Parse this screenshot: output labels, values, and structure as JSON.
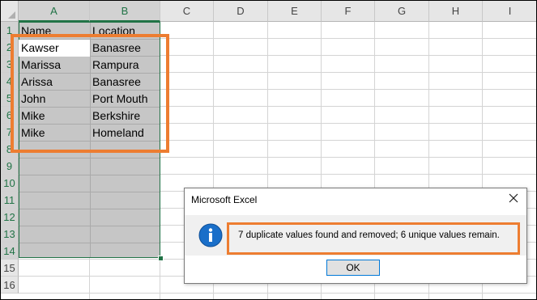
{
  "sheet": {
    "columns": [
      "A",
      "B",
      "C",
      "D",
      "E",
      "F",
      "G",
      "H",
      "I"
    ],
    "rows": [
      "1",
      "2",
      "3",
      "4",
      "5",
      "6",
      "7",
      "8",
      "9",
      "10",
      "11",
      "12",
      "13",
      "14",
      "15",
      "16"
    ],
    "header_row": {
      "name": "Name",
      "location": "Location"
    },
    "records": [
      {
        "name": "Kawser",
        "location": "Banasree"
      },
      {
        "name": "Marissa",
        "location": "Rampura"
      },
      {
        "name": "Arissa",
        "location": "Banasree"
      },
      {
        "name": "John",
        "location": "Port Mouth"
      },
      {
        "name": "Mike",
        "location": "Berkshire"
      },
      {
        "name": "Mike",
        "location": "Homeland"
      }
    ]
  },
  "dialog": {
    "title": "Microsoft Excel",
    "message": "7 duplicate values found and removed; 6 unique values remain.",
    "ok_label": "OK",
    "icon": "info-icon"
  },
  "colors": {
    "highlight_border": "#ed7d31",
    "selection_border": "#217346",
    "selection_fill": "#c6c6c6",
    "header_row_fill": "#fff2cc"
  }
}
